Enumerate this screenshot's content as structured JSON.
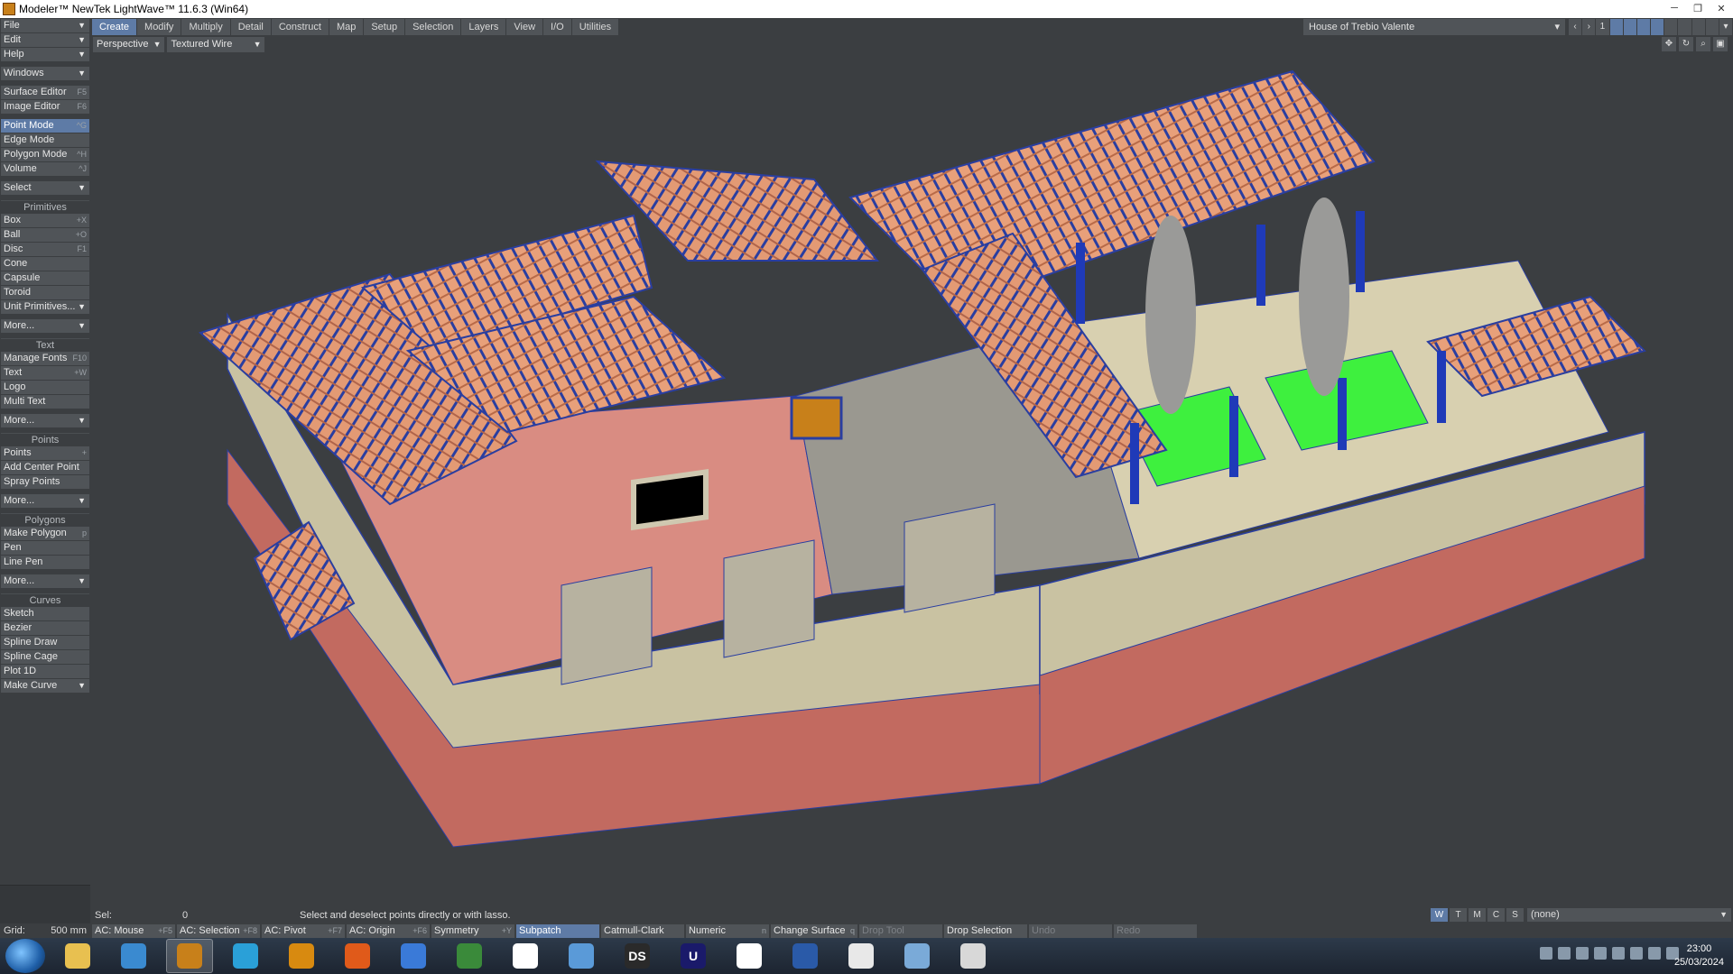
{
  "window": {
    "title": "Modeler™ NewTek LightWave™ 11.6.3 (Win64)"
  },
  "menubar": {
    "tabs": [
      "Create",
      "Modify",
      "Multiply",
      "Detail",
      "Construct",
      "Map",
      "Setup",
      "Selection",
      "Layers",
      "View",
      "I/O",
      "Utilities"
    ],
    "active": "Create"
  },
  "scene": {
    "name": "House of Trebio Valente",
    "layer_number": "1"
  },
  "sidebar": {
    "file": "File",
    "edit": "Edit",
    "help": "Help",
    "windows": "Windows",
    "surface_editor": {
      "label": "Surface Editor",
      "shortcut": "F5"
    },
    "image_editor": {
      "label": "Image Editor",
      "shortcut": "F6"
    },
    "point_mode": {
      "label": "Point Mode",
      "shortcut": "^G"
    },
    "edge_mode": {
      "label": "Edge Mode",
      "shortcut": ""
    },
    "polygon_mode": {
      "label": "Polygon Mode",
      "shortcut": "^H"
    },
    "volume": {
      "label": "Volume",
      "shortcut": "^J"
    },
    "select": "Select",
    "primitives_header": "Primitives",
    "primitives": [
      {
        "label": "Box",
        "shortcut": "+X"
      },
      {
        "label": "Ball",
        "shortcut": "+O"
      },
      {
        "label": "Disc",
        "shortcut": "F1"
      },
      {
        "label": "Cone",
        "shortcut": ""
      },
      {
        "label": "Capsule",
        "shortcut": ""
      },
      {
        "label": "Toroid",
        "shortcut": ""
      }
    ],
    "unit_primitives": "Unit Primitives...",
    "more1": "More...",
    "text_header": "Text",
    "text_items": [
      {
        "label": "Manage Fonts",
        "shortcut": "F10"
      },
      {
        "label": "Text",
        "shortcut": "+W"
      },
      {
        "label": "Logo",
        "shortcut": ""
      },
      {
        "label": "Multi Text",
        "shortcut": ""
      }
    ],
    "more2": "More...",
    "points_header": "Points",
    "points_items": [
      {
        "label": "Points",
        "shortcut": "+"
      },
      {
        "label": "Add Center Point",
        "shortcut": ""
      },
      {
        "label": "Spray Points",
        "shortcut": ""
      }
    ],
    "more3": "More...",
    "polygons_header": "Polygons",
    "polygons_items": [
      {
        "label": "Make Polygon",
        "shortcut": "p"
      },
      {
        "label": "Pen",
        "shortcut": ""
      },
      {
        "label": "Line Pen",
        "shortcut": ""
      }
    ],
    "more4": "More...",
    "curves_header": "Curves",
    "curves_items": [
      {
        "label": "Sketch",
        "shortcut": ""
      },
      {
        "label": "Bezier",
        "shortcut": ""
      },
      {
        "label": "Spline Draw",
        "shortcut": ""
      },
      {
        "label": "Spline Cage",
        "shortcut": ""
      },
      {
        "label": "Plot 1D",
        "shortcut": ""
      }
    ],
    "make_curve": "Make Curve"
  },
  "viewport": {
    "view": "Perspective",
    "shading": "Textured Wire"
  },
  "status": {
    "sel_label": "Sel:",
    "sel_count": "0",
    "hint": "Select and deselect points directly or with lasso.",
    "view_modes": [
      "W",
      "T",
      "M",
      "C",
      "S"
    ],
    "active_mode": "W",
    "surface": "(none)"
  },
  "bottom": {
    "grid_label": "Grid:",
    "grid_value": "500 mm",
    "buttons": [
      {
        "label": "AC: Mouse",
        "shortcut": "+F5"
      },
      {
        "label": "AC: Selection",
        "shortcut": "+F8"
      },
      {
        "label": "AC: Pivot",
        "shortcut": "+F7"
      },
      {
        "label": "AC: Origin",
        "shortcut": "+F6"
      },
      {
        "label": "Symmetry",
        "shortcut": "+Y"
      },
      {
        "label": "Subpatch",
        "shortcut": ""
      },
      {
        "label": "Catmull-Clark",
        "shortcut": ""
      },
      {
        "label": "Numeric",
        "shortcut": "n"
      },
      {
        "label": "Change Surface",
        "shortcut": "q"
      },
      {
        "label": "Drop Tool",
        "shortcut": ""
      },
      {
        "label": "Drop Selection",
        "shortcut": ""
      },
      {
        "label": "Undo",
        "shortcut": ""
      },
      {
        "label": "Redo",
        "shortcut": ""
      }
    ]
  },
  "taskbar": {
    "apps": [
      {
        "name": "file-explorer-icon",
        "color": "#e8c050",
        "text": ""
      },
      {
        "name": "image-viewer-icon",
        "color": "#3a8ad0",
        "text": ""
      },
      {
        "name": "lightwave-icon",
        "color": "#c8801a",
        "text": ""
      },
      {
        "name": "blender-like-icon",
        "color": "#2aa0d8",
        "text": ""
      },
      {
        "name": "gear-app-icon",
        "color": "#d88a10",
        "text": ""
      },
      {
        "name": "firefox-icon",
        "color": "#e05a1a",
        "text": ""
      },
      {
        "name": "thunderbird-icon",
        "color": "#3a7ad8",
        "text": ""
      },
      {
        "name": "spreadsheet-icon",
        "color": "#3a8a3a",
        "text": ""
      },
      {
        "name": "document-icon",
        "color": "#ffffff",
        "text": ""
      },
      {
        "name": "calculator-icon",
        "color": "#5a9ad8",
        "text": ""
      },
      {
        "name": "daz-studio-icon",
        "color": "#2a2a2a",
        "text": "DS"
      },
      {
        "name": "u-app-icon",
        "color": "#1a1a6a",
        "text": "U"
      },
      {
        "name": "red-app-icon",
        "color": "#ffffff",
        "text": ""
      },
      {
        "name": "blue-app-icon",
        "color": "#2a5aa8",
        "text": ""
      },
      {
        "name": "chrome-icon",
        "color": "#e8e8e8",
        "text": ""
      },
      {
        "name": "paint-icon",
        "color": "#7aaad8",
        "text": ""
      },
      {
        "name": "notepad-icon",
        "color": "#d8d8d8",
        "text": ""
      }
    ],
    "time": "23:00",
    "date": "25/03/2024"
  }
}
